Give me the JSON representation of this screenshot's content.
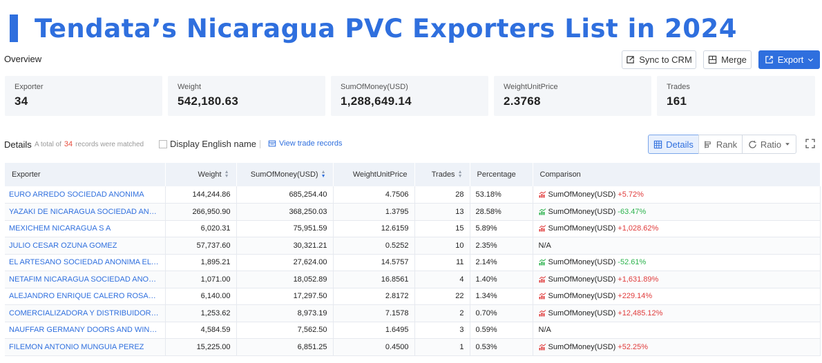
{
  "hero": {
    "title": "Tendata’s Nicaragua PVC Exporters List in 2024"
  },
  "overview": {
    "label": "Overview"
  },
  "buttons": {
    "sync": "Sync to CRM",
    "merge": "Merge",
    "export": "Export"
  },
  "stats": [
    {
      "label": "Exporter",
      "value": "34"
    },
    {
      "label": "Weight",
      "value": "542,180.63"
    },
    {
      "label": "SumOfMoney(USD)",
      "value": "1,288,649.14"
    },
    {
      "label": "WeightUnitPrice",
      "value": "2.3768"
    },
    {
      "label": "Trades",
      "value": "161"
    }
  ],
  "details": {
    "label": "Details",
    "total_prefix": "A total of",
    "total_count": "34",
    "total_suffix": "records were matched",
    "english_name": "Display English name",
    "trade_records": "View trade records",
    "tabs": {
      "details": "Details",
      "rank": "Rank",
      "ratio": "Ratio"
    }
  },
  "table": {
    "headers": {
      "exporter": "Exporter",
      "weight": "Weight",
      "sum": "SumOfMoney(USD)",
      "unit_price": "WeightUnitPrice",
      "trades": "Trades",
      "percentage": "Percentage",
      "comparison": "Comparison"
    },
    "rows": [
      {
        "exporter": "EURO ARREDO SOCIEDAD ANONIMA",
        "weight": "144,244.86",
        "sum": "685,254.40",
        "unit_price": "4.7506",
        "trades": "28",
        "percentage": "53.18%",
        "cmp_label": "SumOfMoney(USD)",
        "cmp_value": "+5.72%",
        "dir": "up"
      },
      {
        "exporter": "YAZAKI DE NICARAGUA SOCIEDAD ANONIM",
        "weight": "266,950.90",
        "sum": "368,250.03",
        "unit_price": "1.3795",
        "trades": "13",
        "percentage": "28.58%",
        "cmp_label": "SumOfMoney(USD)",
        "cmp_value": "-63.47%",
        "dir": "down"
      },
      {
        "exporter": "MEXICHEM NICARAGUA S A",
        "weight": "6,020.31",
        "sum": "75,951.59",
        "unit_price": "12.6159",
        "trades": "15",
        "percentage": "5.89%",
        "cmp_label": "SumOfMoney(USD)",
        "cmp_value": "+1,028.62%",
        "dir": "up"
      },
      {
        "exporter": "JULIO CESAR OZUNA GOMEZ",
        "weight": "57,737.60",
        "sum": "30,321.21",
        "unit_price": "0.5252",
        "trades": "10",
        "percentage": "2.35%",
        "cmp_label": "N/A",
        "cmp_value": "",
        "dir": "none"
      },
      {
        "exporter": "EL ARTESANO SOCIEDAD ANONIMA EL ARTESANO",
        "weight": "1,895.21",
        "sum": "27,624.00",
        "unit_price": "14.5757",
        "trades": "11",
        "percentage": "2.14%",
        "cmp_label": "SumOfMoney(USD)",
        "cmp_value": "-52.61%",
        "dir": "down"
      },
      {
        "exporter": "NETAFIM NICARAGUA SOCIEDAD ANONIMA",
        "weight": "1,071.00",
        "sum": "18,052.89",
        "unit_price": "16.8561",
        "trades": "4",
        "percentage": "1.40%",
        "cmp_label": "SumOfMoney(USD)",
        "cmp_value": "+1,631.89%",
        "dir": "up"
      },
      {
        "exporter": "ALEJANDRO ENRIQUE CALERO ROSALES",
        "weight": "6,140.00",
        "sum": "17,297.50",
        "unit_price": "2.8172",
        "trades": "22",
        "percentage": "1.34%",
        "cmp_label": "SumOfMoney(USD)",
        "cmp_value": "+229.14%",
        "dir": "up"
      },
      {
        "exporter": "COMERCIALIZADORA Y DISTRIBUIDORA N",
        "weight": "1,253.62",
        "sum": "8,973.19",
        "unit_price": "7.1578",
        "trades": "2",
        "percentage": "0.70%",
        "cmp_label": "SumOfMoney(USD)",
        "cmp_value": "+12,485.12%",
        "dir": "up"
      },
      {
        "exporter": "NAUFFAR GERMANY DOORS AND WINDOWS SOCIEDAD",
        "weight": "4,584.59",
        "sum": "7,562.50",
        "unit_price": "1.6495",
        "trades": "3",
        "percentage": "0.59%",
        "cmp_label": "N/A",
        "cmp_value": "",
        "dir": "none"
      },
      {
        "exporter": "FILEMON ANTONIO MUNGUIA PEREZ",
        "weight": "15,225.00",
        "sum": "6,851.25",
        "unit_price": "0.4500",
        "trades": "1",
        "percentage": "0.53%",
        "cmp_label": "SumOfMoney(USD)",
        "cmp_value": "+52.25%",
        "dir": "up"
      }
    ]
  },
  "colors": {
    "accent": "#2f6fde",
    "up": "#e03b3b",
    "down": "#2bb24c",
    "highlight": "#e74c3c"
  }
}
